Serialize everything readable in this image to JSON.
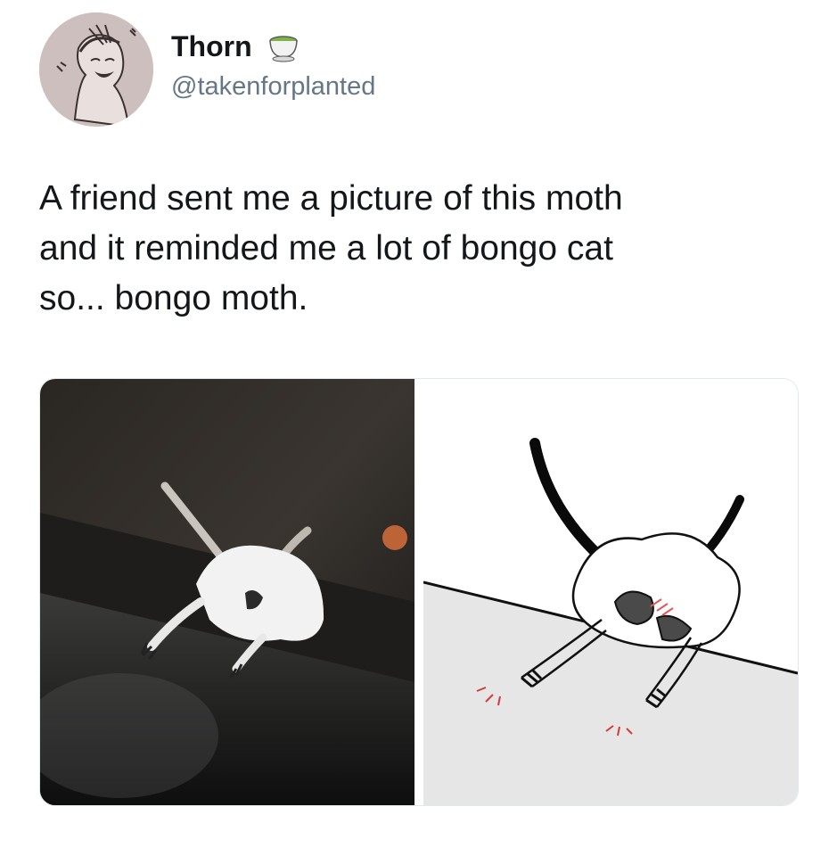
{
  "user": {
    "display_name": "Thorn",
    "handle": "@takenforplanted",
    "name_badge_icon": "tea-cup-icon"
  },
  "tweet": {
    "text_lines": [
      "A friend sent me a picture of this moth",
      "and it reminded me a lot of bongo cat",
      "so... bongo moth."
    ]
  },
  "media": {
    "left_image": "photo of white moth on a dark ledge",
    "right_image": "drawing of moth as bongo cat"
  },
  "colors": {
    "name": "#14171a",
    "handle": "#657786",
    "border": "#e1e8ed"
  }
}
